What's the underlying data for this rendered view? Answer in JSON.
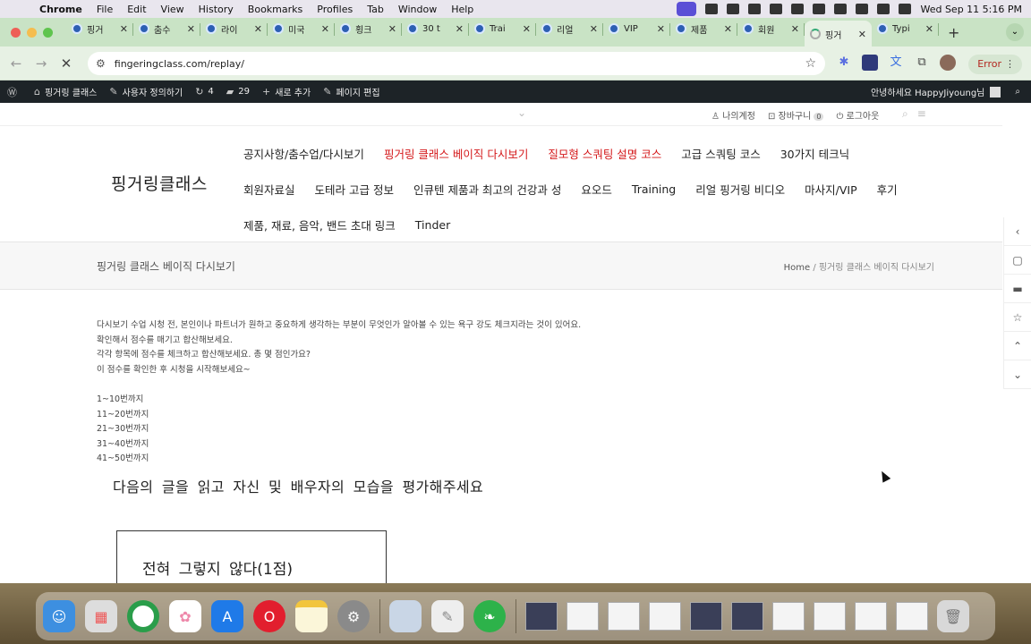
{
  "menubar": {
    "app": "Chrome",
    "items": [
      "File",
      "Edit",
      "View",
      "History",
      "Bookmarks",
      "Profiles",
      "Tab",
      "Window",
      "Help"
    ],
    "datetime": "Wed Sep 11  5:16 PM"
  },
  "tabs": [
    {
      "label": "핑거"
    },
    {
      "label": "춤수"
    },
    {
      "label": "라이"
    },
    {
      "label": "미국"
    },
    {
      "label": "횡크"
    },
    {
      "label": "30 t"
    },
    {
      "label": "Trai"
    },
    {
      "label": "리얼"
    },
    {
      "label": "VIP"
    },
    {
      "label": "제품"
    },
    {
      "label": "회원"
    },
    {
      "label": "핑거",
      "active": true
    },
    {
      "label": "Typi"
    }
  ],
  "toolbar": {
    "url": "fingeringclass.com/replay/",
    "error_label": "Error"
  },
  "wpbar": {
    "site": "핑거링 클래스",
    "customize": "사용자 정의하기",
    "updates": "4",
    "comments": "29",
    "new": "새로 추가",
    "edit": "페이지 편집",
    "greeting": "안녕하세요 HappyJiyoung님"
  },
  "utility": {
    "account": "나의계정",
    "cart": "장바구니",
    "cart_count": "0",
    "logout": "로그아웃"
  },
  "site": {
    "logo": "핑거링클래스",
    "nav_row1": [
      {
        "label": "공지사항/춤수업/다시보기",
        "highlight": false
      },
      {
        "label": "핑거링 클래스 베이직 다시보기",
        "highlight": true
      },
      {
        "label": "질모형 스쿼팅 설명 코스",
        "highlight": true
      },
      {
        "label": "고급 스쿼팅 코스",
        "highlight": false
      },
      {
        "label": "30가지 테크닉",
        "highlight": false
      }
    ],
    "nav_row2": [
      "회원자료실",
      "도테라 고급 정보",
      "인큐텐 제품과 최고의 건강과 성",
      "요오드",
      "Training",
      "리얼 핑거링 비디오",
      "마사지/VIP",
      "후기"
    ],
    "nav_row3": [
      "제품, 재료, 음악, 밴드 초대 링크",
      "Tinder"
    ]
  },
  "page": {
    "title": "핑거링 클래스 베이직 다시보기",
    "breadcrumb_home": "Home",
    "breadcrumb_current": "/ 핑거링 클래스 베이직 다시보기",
    "intro": [
      "다시보기 수업 시청 전, 본인이나 파트너가 원하고 중요하게 생각하는 부분이 무엇인가 알아볼 수 있는 욕구 강도 체크지라는 것이 있어요.",
      "확인해서 점수를 매기고 합산해보세요.",
      "각각 항목에 점수를 체크하고 합산해보세요. 총 몇 점인가요?",
      "이 점수를 확인한 후 시청을 시작해보세요~"
    ],
    "ranges": [
      "1~10번까지",
      "11~20번까지",
      "21~30번까지",
      "31~40번까지",
      "41~50번까지"
    ],
    "heading": "다음의 글을 읽고 자신 및 배우자의 모습을 평가해주세요",
    "answer_option": "전혀 그렇지 않다(1점)"
  },
  "colors": {
    "nav_highlight": "#d4181a",
    "tabstrip": "#c9e3c5",
    "wpbar": "#1d2327"
  }
}
